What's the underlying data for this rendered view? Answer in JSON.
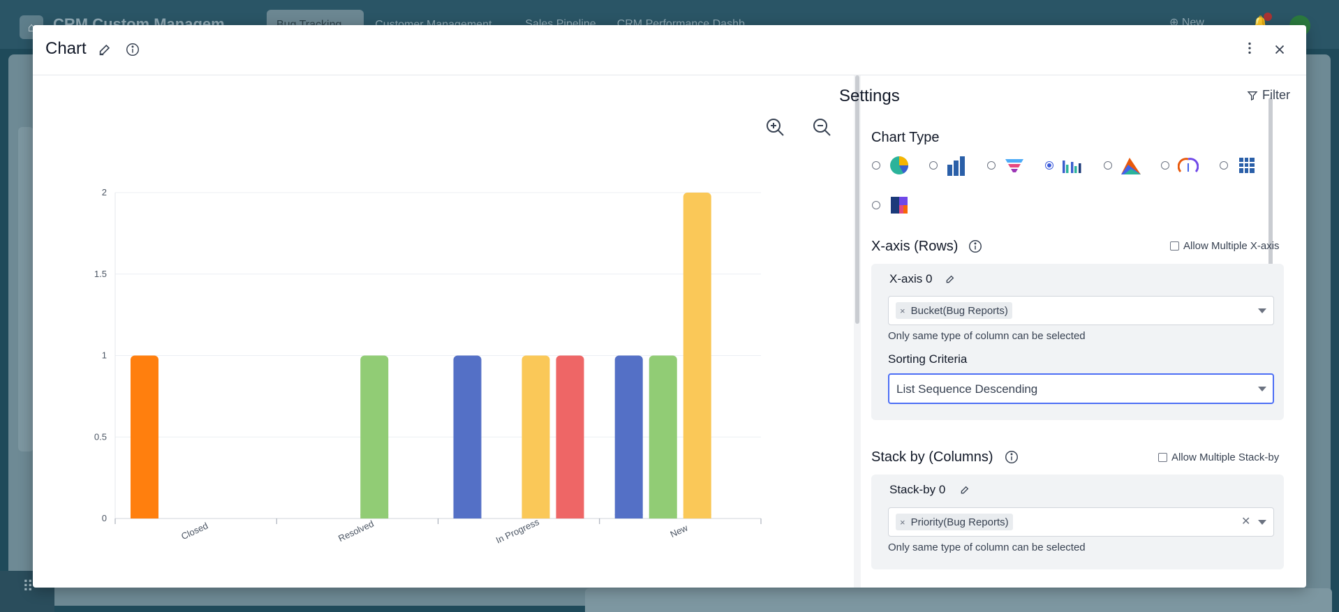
{
  "background": {
    "app_title": "CRM Custom Managem",
    "tabs": [
      {
        "label": "Bug Tracking ⌄",
        "active": true
      },
      {
        "label": "Customer Management ⌄",
        "active": false
      },
      {
        "label": "Sales Pipeline",
        "active": false
      },
      {
        "label": "CRM Performance Dashb",
        "active": false
      }
    ],
    "new_label": "⊕ New"
  },
  "modal": {
    "title": "Chart"
  },
  "chart_data": {
    "type": "bar",
    "categories": [
      "Closed",
      "Resolved",
      "In Progress",
      "New"
    ],
    "ylim": [
      0,
      2
    ],
    "yticks": [
      "0",
      "0.5",
      "1",
      "1.5",
      "2"
    ],
    "bars": [
      {
        "category": "Closed",
        "value": 1,
        "color": "#FF7F0E"
      },
      {
        "category": "Resolved",
        "value": 1,
        "color": "#91CC75"
      },
      {
        "category": "In Progress",
        "value": 1,
        "color": "#5470C6"
      },
      {
        "category": "In Progress",
        "value": 1,
        "color": "#FAC858"
      },
      {
        "category": "In Progress",
        "value": 1,
        "color": "#EE6666"
      },
      {
        "category": "New",
        "value": 1,
        "color": "#5470C6"
      },
      {
        "category": "New",
        "value": 1,
        "color": "#91CC75"
      },
      {
        "category": "New",
        "value": 2,
        "color": "#FAC858"
      }
    ],
    "grid": true,
    "legend": "none"
  },
  "settings": {
    "title": "Settings",
    "filter_label": "Filter",
    "chart_type_label": "Chart Type",
    "chart_types": [
      {
        "icon": "pie-chart-icon",
        "checked": false
      },
      {
        "icon": "bar-chart-icon",
        "checked": false
      },
      {
        "icon": "funnel-chart-icon",
        "checked": false
      },
      {
        "icon": "grouped-bar-chart-icon",
        "checked": true
      },
      {
        "icon": "area-chart-icon",
        "checked": false
      },
      {
        "icon": "gauge-chart-icon",
        "checked": false
      },
      {
        "icon": "pivot-table-icon",
        "checked": false
      },
      {
        "icon": "heatmap-chart-icon",
        "checked": false
      }
    ],
    "xaxis": {
      "section_label": "X-axis (Rows)",
      "allow_multiple_label": "Allow Multiple X-axis",
      "item_label": "X-axis 0",
      "chip_label": "Bucket(Bug Reports)",
      "helper": "Only same type of column can be selected",
      "sorting_label": "Sorting Criteria",
      "sorting_value": "List Sequence Descending"
    },
    "stackby": {
      "section_label": "Stack by (Columns)",
      "allow_multiple_label": "Allow Multiple Stack-by",
      "item_label": "Stack-by 0",
      "chip_label": "Priority(Bug Reports)",
      "helper": "Only same type of column can be selected"
    }
  }
}
